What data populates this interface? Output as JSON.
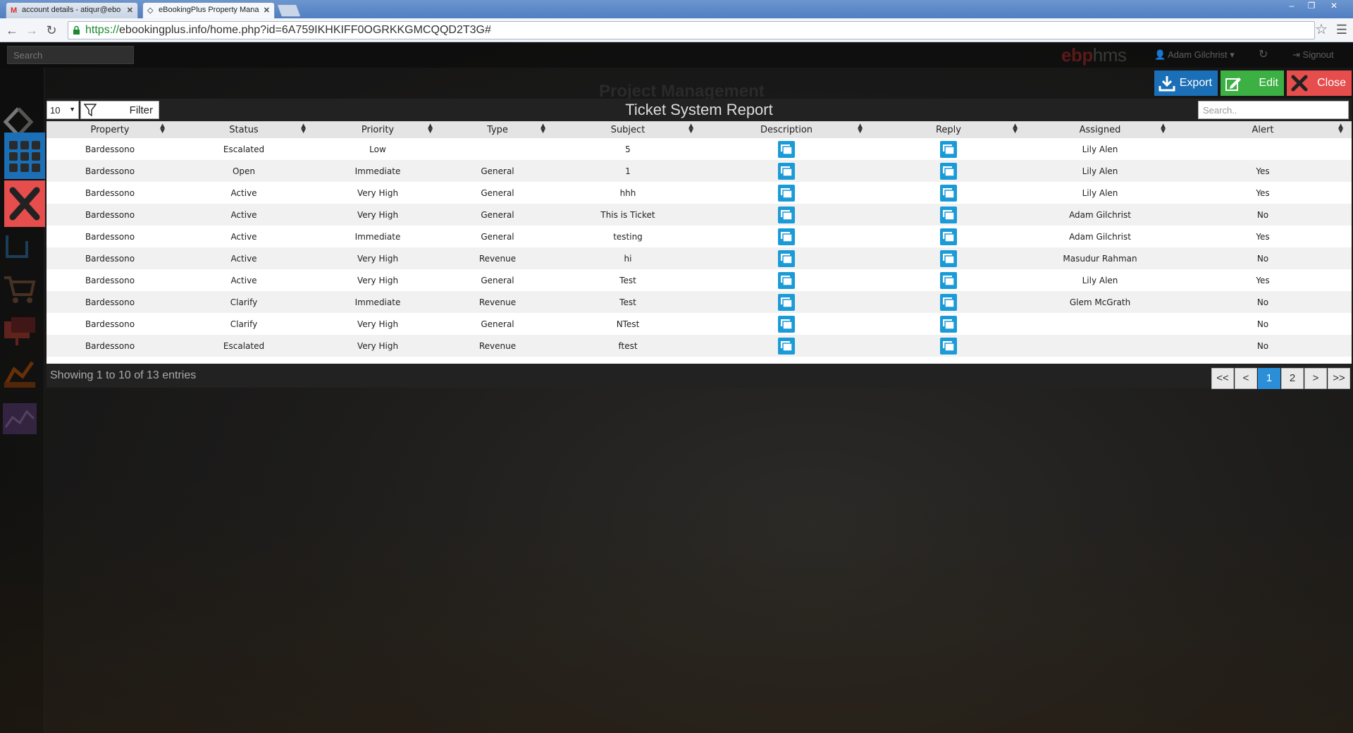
{
  "browser": {
    "tabs": [
      {
        "title": "account details - atiqur@ebo",
        "icon": "gmail-icon"
      },
      {
        "title": "eBookingPlus Property Mana",
        "icon": "site-icon"
      }
    ],
    "url_scheme": "https://",
    "url_rest": "ebookingplus.info/home.php?id=6A759IKHKIFF0OGRKKGMCQQD2T3G#",
    "window_controls": [
      "–",
      "❐",
      "✕"
    ]
  },
  "topbar": {
    "search_placeholder": "Search",
    "brand_part1": "ebp",
    "brand_part2": "hms",
    "user": "Adam Gilchrist",
    "signout": "Signout"
  },
  "page": {
    "background_title": "Project Management"
  },
  "actions": {
    "export": "Export",
    "edit": "Edit",
    "close": "Close"
  },
  "toolbar": {
    "page_length": "10",
    "filter": "Filter",
    "title": "Ticket System Report",
    "search_placeholder": "Search.."
  },
  "table": {
    "columns": [
      "Property",
      "Status",
      "Priority",
      "Type",
      "Subject",
      "Description",
      "Reply",
      "Assigned",
      "Alert"
    ],
    "rows": [
      {
        "property": "Bardessono",
        "status": "Escalated",
        "priority": "Low",
        "type": "",
        "subject": "5",
        "assigned": "Lily Alen",
        "alert": ""
      },
      {
        "property": "Bardessono",
        "status": "Open",
        "priority": "Immediate",
        "type": "General",
        "subject": "1",
        "assigned": "Lily Alen",
        "alert": "Yes"
      },
      {
        "property": "Bardessono",
        "status": "Active",
        "priority": "Very High",
        "type": "General",
        "subject": "hhh",
        "assigned": "Lily Alen",
        "alert": "Yes"
      },
      {
        "property": "Bardessono",
        "status": "Active",
        "priority": "Very High",
        "type": "General",
        "subject": "This is Ticket",
        "assigned": "Adam Gilchrist",
        "alert": "No"
      },
      {
        "property": "Bardessono",
        "status": "Active",
        "priority": "Immediate",
        "type": "General",
        "subject": "testing",
        "assigned": "Adam Gilchrist",
        "alert": "Yes"
      },
      {
        "property": "Bardessono",
        "status": "Active",
        "priority": "Very High",
        "type": "Revenue",
        "subject": "hi",
        "assigned": "Masudur Rahman",
        "alert": "No"
      },
      {
        "property": "Bardessono",
        "status": "Active",
        "priority": "Very High",
        "type": "General",
        "subject": "Test",
        "assigned": "Lily Alen",
        "alert": "Yes"
      },
      {
        "property": "Bardessono",
        "status": "Clarify",
        "priority": "Immediate",
        "type": "Revenue",
        "subject": "Test",
        "assigned": "Glem McGrath",
        "alert": "No"
      },
      {
        "property": "Bardessono",
        "status": "Clarify",
        "priority": "Very High",
        "type": "General",
        "subject": "NTest",
        "assigned": "",
        "alert": "No"
      },
      {
        "property": "Bardessono",
        "status": "Escalated",
        "priority": "Very High",
        "type": "Revenue",
        "subject": "ftest",
        "assigned": "",
        "alert": "No"
      }
    ]
  },
  "footer": {
    "info": "Showing 1 to 10 of 13 entries",
    "pager": [
      "<<",
      "<",
      "1",
      "2",
      ">",
      ">>"
    ],
    "current_page": "1"
  },
  "colors": {
    "export": "#1b6fb6",
    "edit": "#3cb043",
    "close": "#e64d4d",
    "page_active": "#2a8fd8",
    "icon_blue": "#1a9bd7"
  }
}
